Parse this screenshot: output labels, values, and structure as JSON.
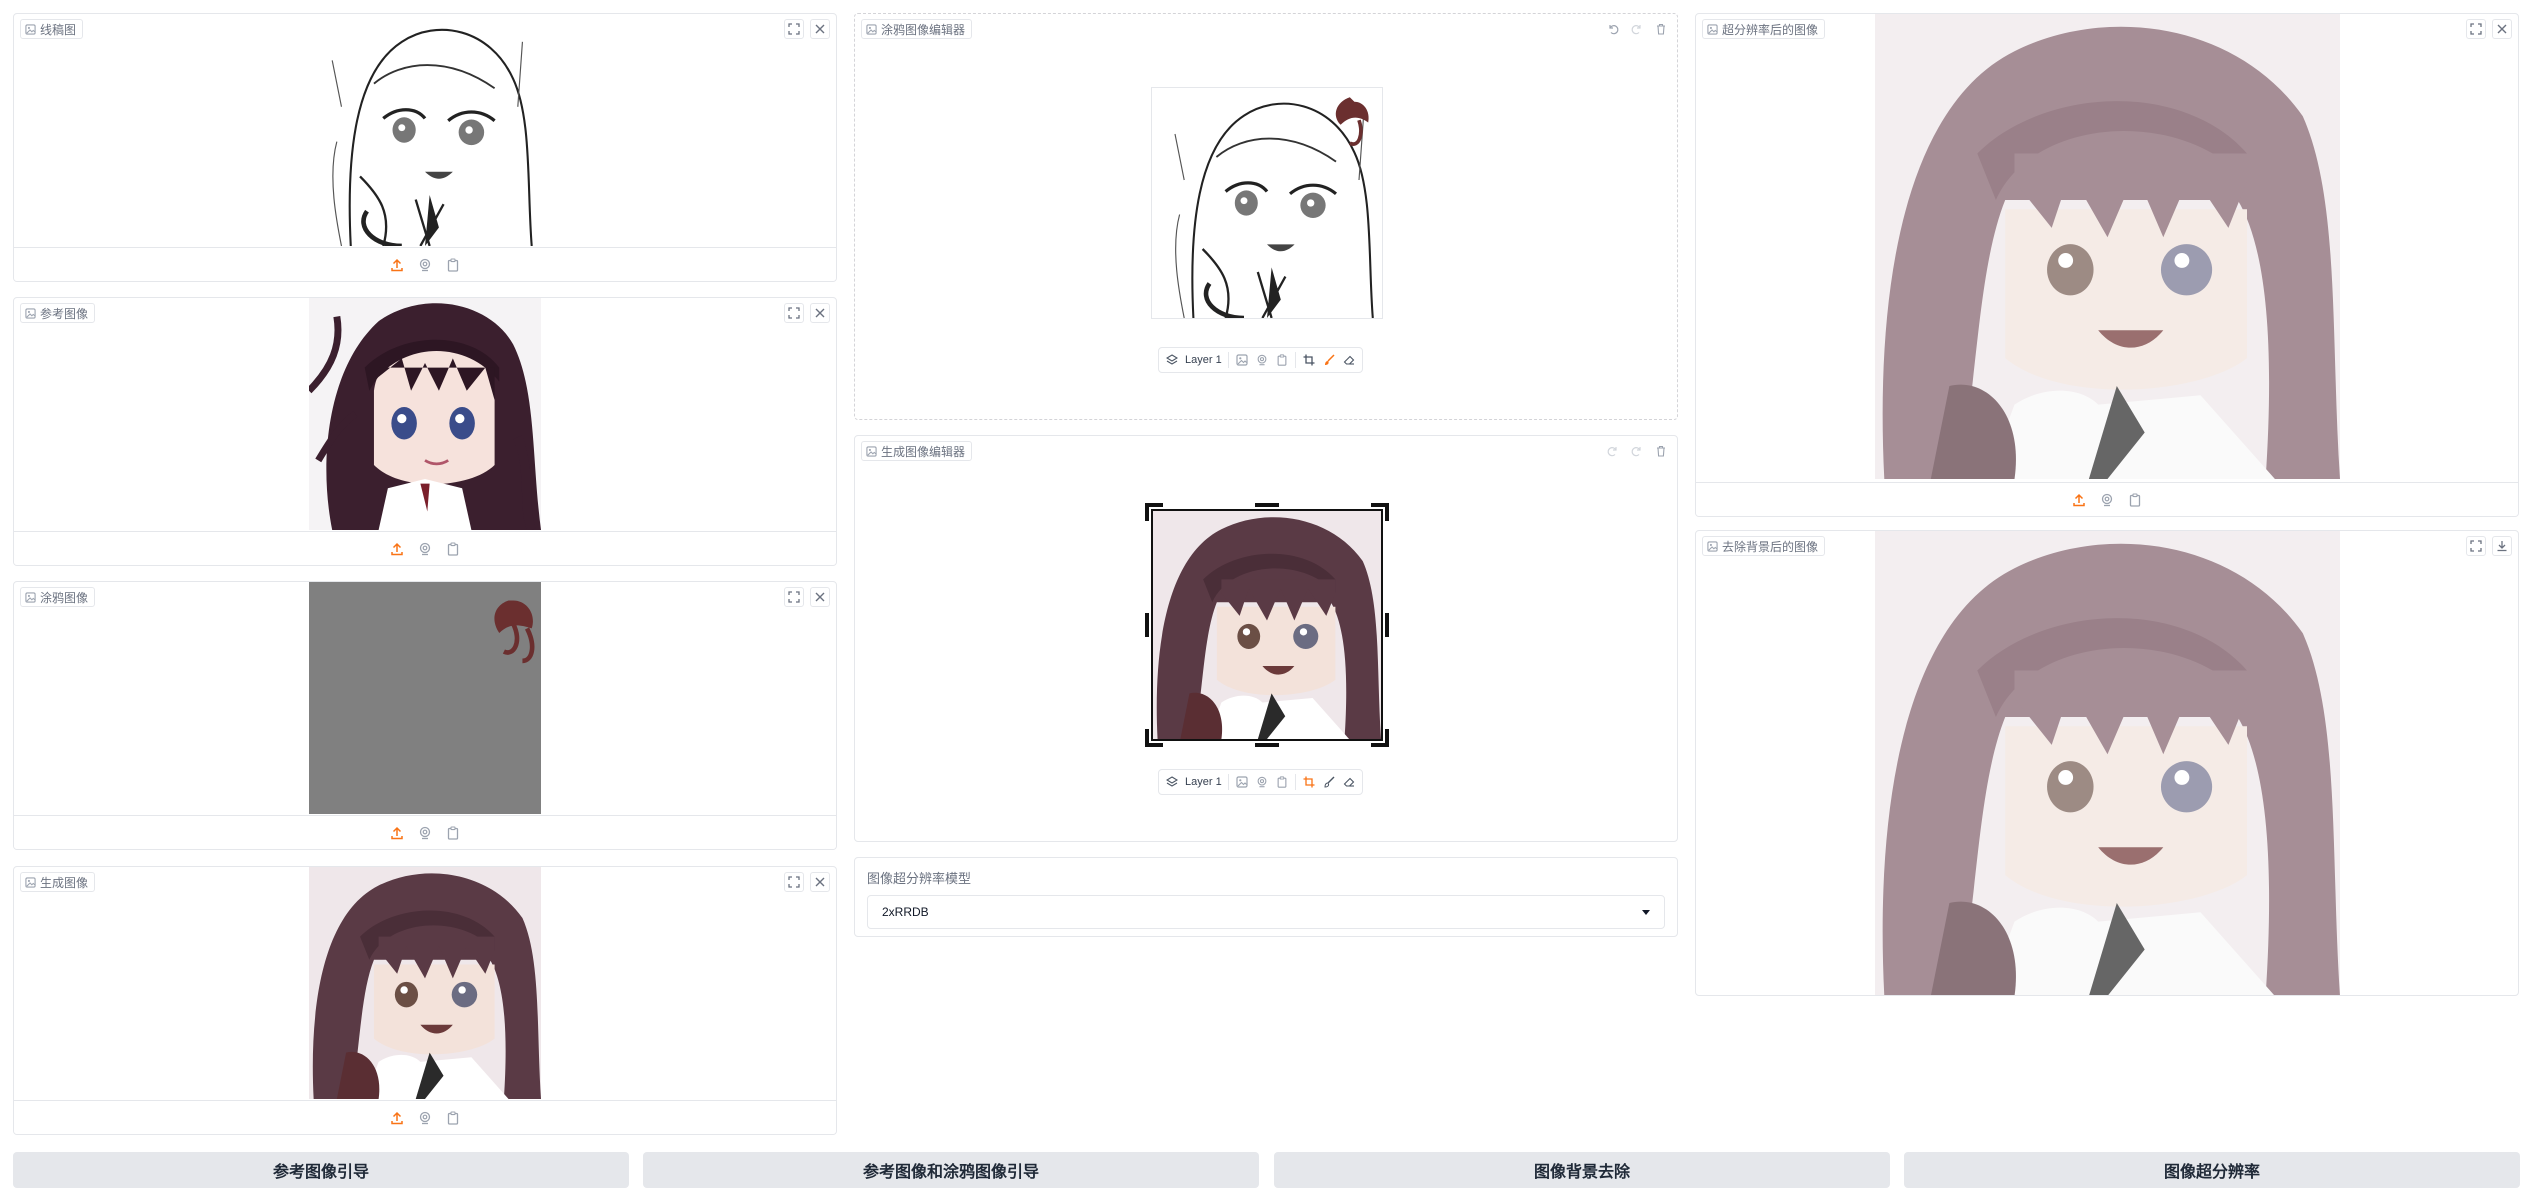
{
  "left_panels": [
    {
      "label": "线稿图"
    },
    {
      "label": "参考图像"
    },
    {
      "label": "涂鸦图像"
    },
    {
      "label": "生成图像"
    }
  ],
  "sketch_editor": {
    "label": "涂鸦图像编辑器",
    "layer_label": "Layer 1"
  },
  "gen_editor": {
    "label": "生成图像编辑器",
    "layer_label": "Layer 1"
  },
  "superres": {
    "label": "图像超分辨率模型",
    "selected": "2xRRDB"
  },
  "right_panels": [
    {
      "label": "超分辨率后的图像"
    },
    {
      "label": "去除背景后的图像"
    }
  ],
  "buttons": [
    {
      "label": "参考图像引导"
    },
    {
      "label": "参考图像和涂鸦图像引导"
    },
    {
      "label": "图像背景去除"
    },
    {
      "label": "图像超分辨率"
    }
  ],
  "colors": {
    "accent": "#f97316",
    "border": "#e5e7eb",
    "button_bg": "#e5e7eb"
  }
}
